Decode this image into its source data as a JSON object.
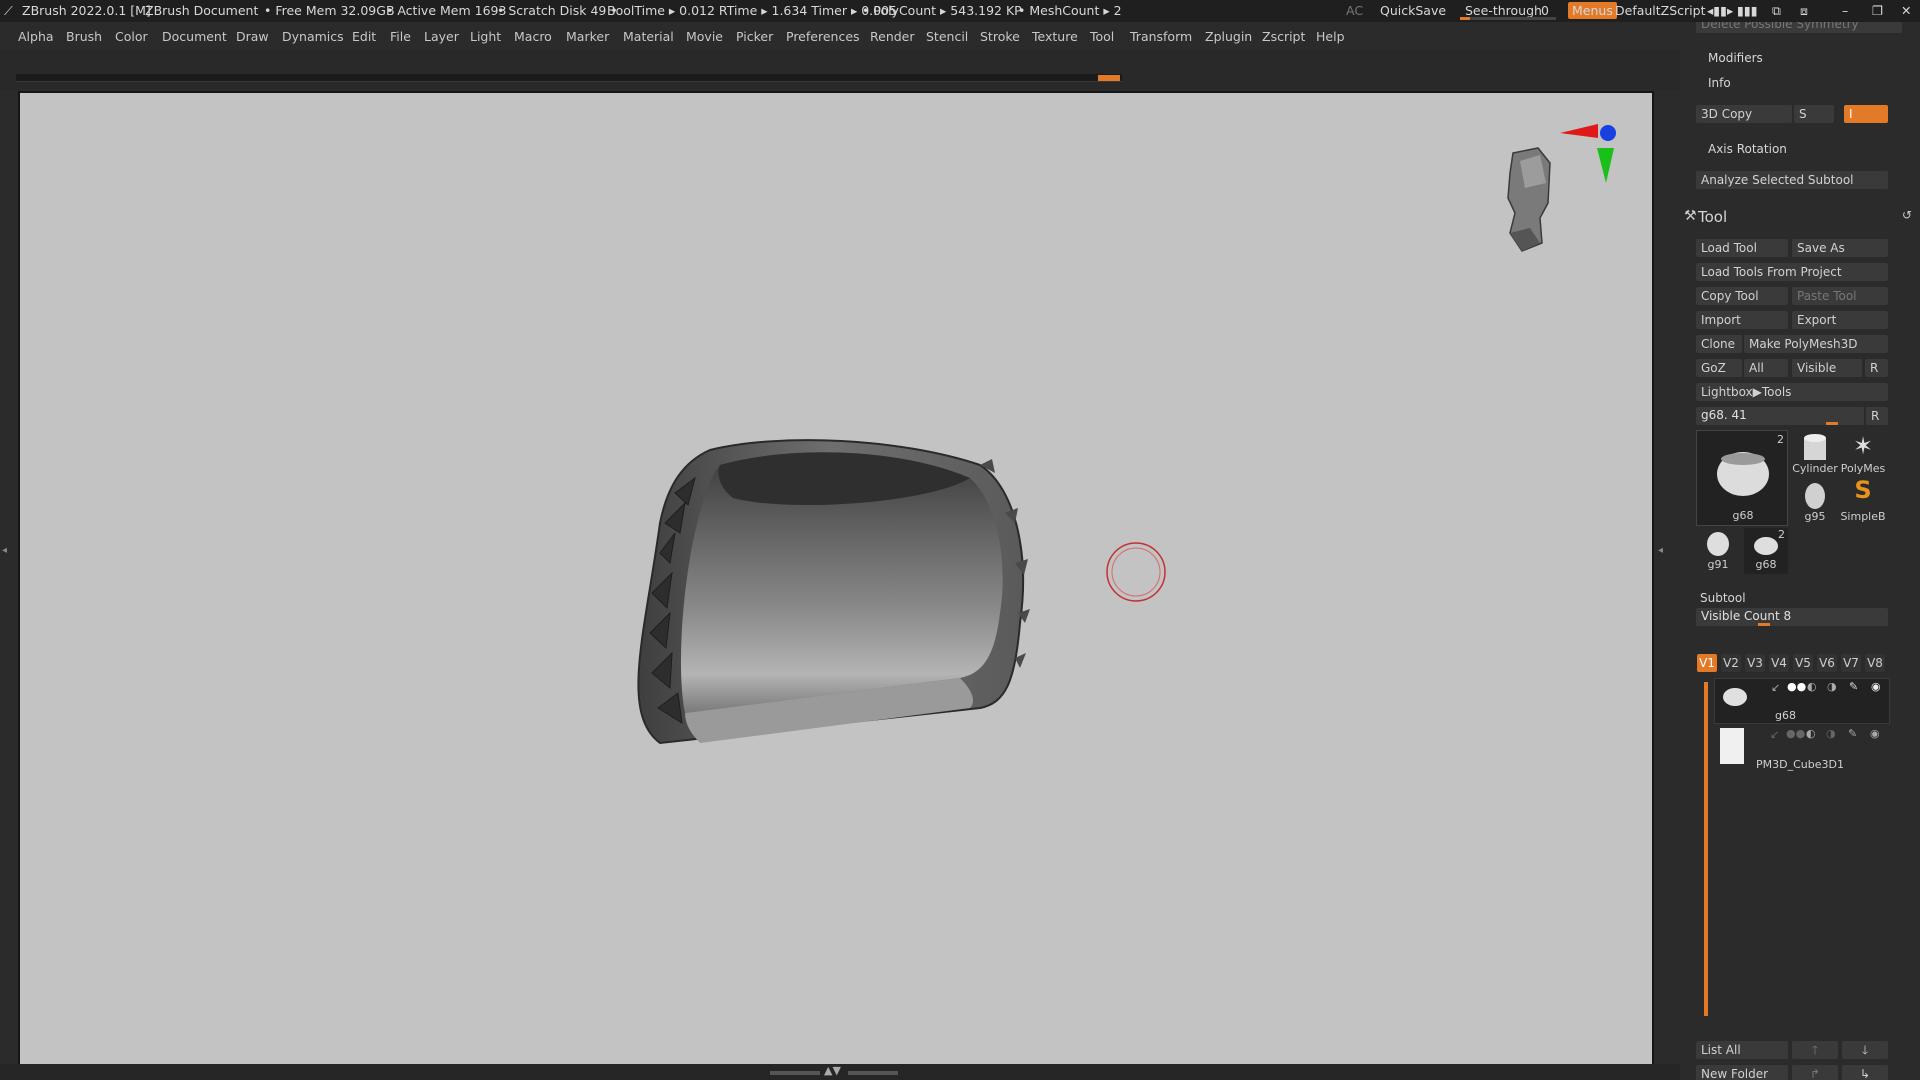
{
  "title_bar": {
    "app": "ZBrush 2022.0.1 [M]",
    "document": "ZBrush Document",
    "free_mem": "• Free Mem 32.09GB",
    "active_mem": "• Active Mem 1693",
    "scratch_disk": "• Scratch Disk 49 •",
    "booltime": "BoolTime ▸ 0.012 RTime ▸ 1.634 Timer ▸ 0.005",
    "polycount": "• PolyCount ▸ 543.192 KP",
    "meshcount": "• MeshCount ▸ 2",
    "ac": "AC",
    "quicksave": "QuickSave",
    "see_through_label": "See-through",
    "see_through_value": "0",
    "menus": "Menus",
    "script": "DefaultZScript"
  },
  "menu": [
    "Alpha",
    "Brush",
    "Color",
    "Document",
    "Draw",
    "Dynamics",
    "Edit",
    "File",
    "Layer",
    "Light",
    "Macro",
    "Marker",
    "Material",
    "Movie",
    "Picker",
    "Preferences",
    "Render",
    "Stencil",
    "Stroke",
    "Texture",
    "Tool",
    "Transform",
    "Zplugin",
    "Zscript",
    "Help"
  ],
  "right_panel": {
    "truncated_top": "Delete Possible Symmetry",
    "modifiers": "Modifiers",
    "info": "Info",
    "copy3d": "3D Copy",
    "s_label": "S",
    "i_value": "I",
    "axis_rotation": "Axis Rotation",
    "analyze": "Analyze Selected Subtool",
    "tool_title": "Tool",
    "load_tool": "Load Tool",
    "save_as": "Save As",
    "load_tools_project": "Load Tools From Project",
    "copy_tool": "Copy Tool",
    "paste_tool": "Paste Tool",
    "import": "Import",
    "export": "Export",
    "clone": "Clone",
    "make_polymesh": "Make PolyMesh3D",
    "goz": "GoZ",
    "all": "All",
    "visible": "Visible",
    "r": "R",
    "lightbox": "Lightbox▶Tools",
    "current_tool": "g68. 41",
    "thumbs": {
      "main_label": "g68",
      "main_count": "2",
      "cylinder": "Cylinder",
      "polymesh": "PolyMes",
      "g95": "g95",
      "simpleb": "SimpleB",
      "g91": "g91",
      "g68b": "g68",
      "g68b_count": "2"
    },
    "subtool": "Subtool",
    "visible_count": "Visible Count 8",
    "vtabs": [
      "V1",
      "V2",
      "V3",
      "V4",
      "V5",
      "V6",
      "V7",
      "V8"
    ],
    "subtools": [
      "g68",
      "PM3D_Cube3D1"
    ],
    "list_all": "List All",
    "new_folder": "New Folder"
  }
}
